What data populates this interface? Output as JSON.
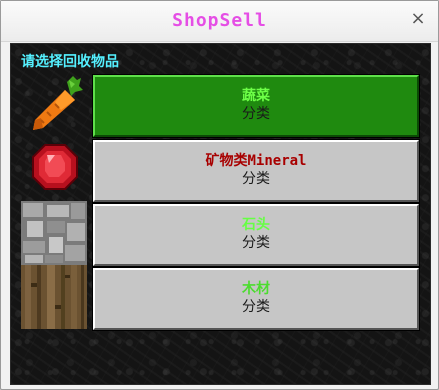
{
  "window": {
    "title": "ShopSell",
    "close_label": "×"
  },
  "heading": "请选择回收物品",
  "items": [
    {
      "name": "蔬菜",
      "category": "分类",
      "name_color": "#6dff47",
      "icon": "carrot-icon",
      "selected": true
    },
    {
      "name": "矿物类Mineral",
      "category": "分类",
      "name_color": "#a80000",
      "icon": "ruby-icon",
      "selected": false
    },
    {
      "name": "石头",
      "category": "分类",
      "name_color": "#66ff44",
      "icon": "cobblestone-icon",
      "selected": false
    },
    {
      "name": "木材",
      "category": "分类",
      "name_color": "#4cdc2f",
      "icon": "wood-block-icon",
      "selected": false
    }
  ]
}
